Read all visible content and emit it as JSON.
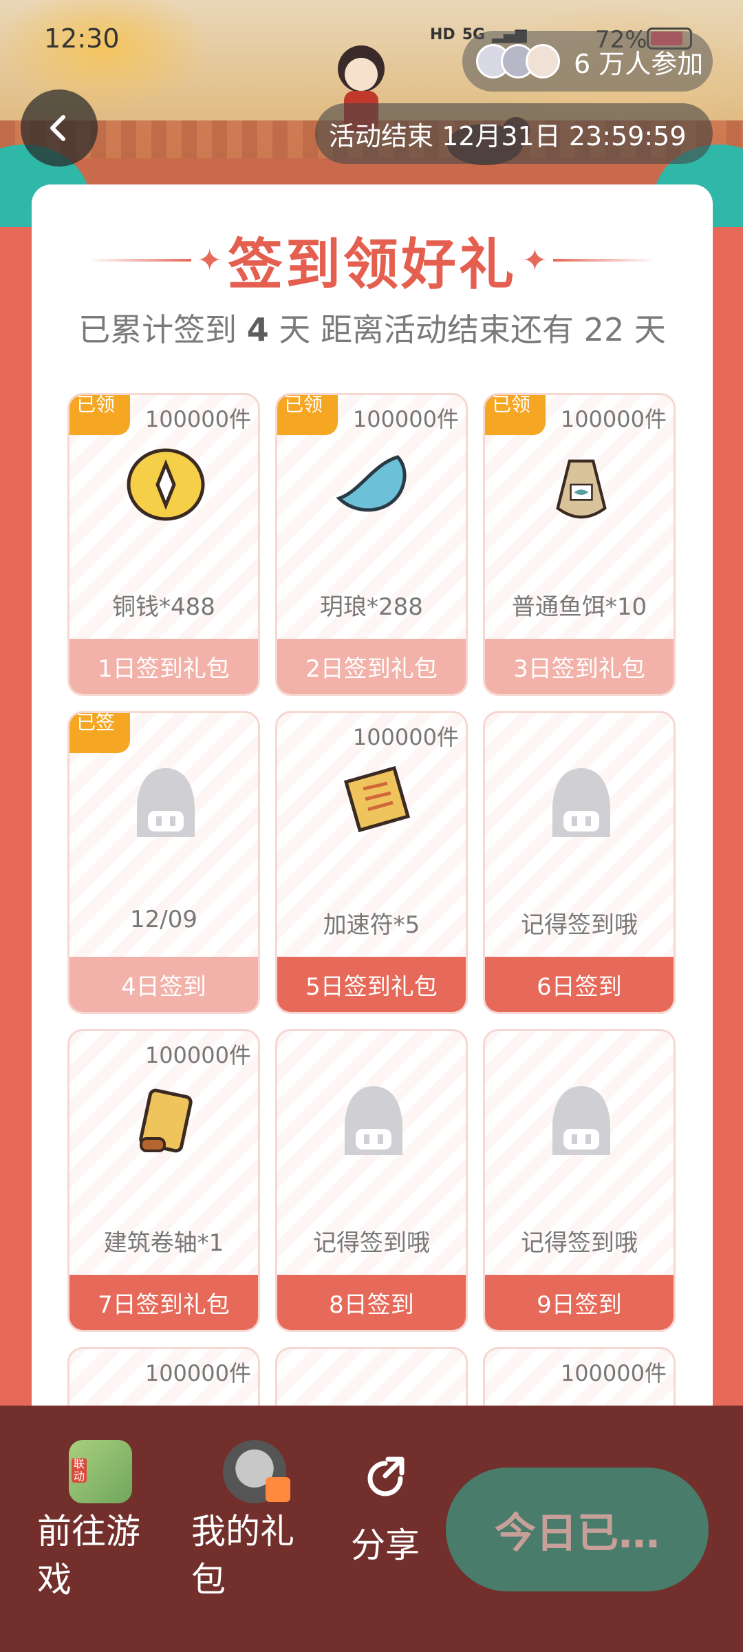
{
  "status_bar": {
    "time": "12:30",
    "battery": "72%",
    "network": "5G"
  },
  "header": {
    "participants": "6 万人参加",
    "end_time": "活动结束 12月31日 23:59:59"
  },
  "card": {
    "title": "签到领好礼",
    "subtitle_prefix": "已累计签到",
    "days_signed": "4",
    "subtitle_mid": "天 距离活动结束还有",
    "days_left": "22",
    "subtitle_suffix": "天"
  },
  "cells": [
    {
      "tag": "已领",
      "qty": "100000件",
      "name": "铜钱*488",
      "button": "1日签到礼包",
      "state": "claimed"
    },
    {
      "tag": "已领",
      "qty": "100000件",
      "name": "玥琅*288",
      "button": "2日签到礼包",
      "state": "claimed"
    },
    {
      "tag": "已领",
      "qty": "100000件",
      "name": "普通鱼饵*10",
      "button": "3日签到礼包",
      "state": "claimed"
    },
    {
      "tag": "已签",
      "qty": "",
      "name": "12/09",
      "button": "4日签到",
      "state": "claimed"
    },
    {
      "tag": "",
      "qty": "100000件",
      "name": "加速符*5",
      "button": "5日签到礼包",
      "state": "upcoming"
    },
    {
      "tag": "",
      "qty": "",
      "name": "记得签到哦",
      "button": "6日签到",
      "state": "upcoming"
    },
    {
      "tag": "",
      "qty": "100000件",
      "name": "建筑卷轴*1",
      "button": "7日签到礼包",
      "state": "upcoming"
    },
    {
      "tag": "",
      "qty": "",
      "name": "记得签到哦",
      "button": "8日签到",
      "state": "upcoming"
    },
    {
      "tag": "",
      "qty": "",
      "name": "记得签到哦",
      "button": "9日签到",
      "state": "upcoming"
    },
    {
      "tag": "",
      "qty": "100000件",
      "name": "",
      "button": "",
      "state": "upcoming"
    },
    {
      "tag": "",
      "qty": "",
      "name": "",
      "button": "",
      "state": "upcoming"
    },
    {
      "tag": "",
      "qty": "100000件",
      "name": "",
      "button": "",
      "state": "upcoming"
    }
  ],
  "bottom_bar": {
    "game_label": "前往游戏",
    "game_badge": "联动",
    "gift_label": "我的礼包",
    "share_label": "分享",
    "today_button": "今日已…"
  },
  "colors": {
    "accent": "#e6695a",
    "tag": "#f5a623",
    "bottom_bg": "#722f2b",
    "today_btn": "#4a7c6b"
  }
}
